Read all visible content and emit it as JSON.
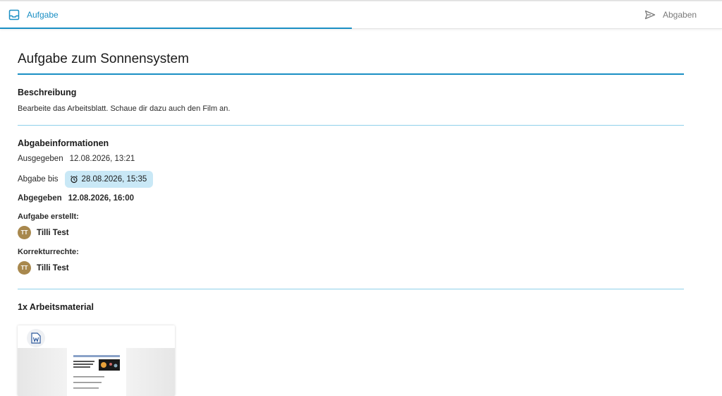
{
  "tabs": [
    {
      "label": "Aufgabe",
      "icon": "inbox-icon",
      "active": true
    },
    {
      "label": "Abgaben",
      "icon": "send-icon",
      "active": false
    }
  ],
  "task": {
    "title": "Aufgabe zum Sonnensystem",
    "description_heading": "Beschreibung",
    "description": "Bearbeite das Arbeitsblatt. Schaue dir dazu auch den Film an."
  },
  "submission_info": {
    "heading": "Abgabeinformationen",
    "issued_label": "Ausgegeben",
    "issued_value": "12.08.2026, 13:21",
    "due_label": "Abgabe bis",
    "due_value": "28.08.2026, 15:35",
    "submitted_label": "Abgegeben",
    "submitted_value": "12.08.2026, 16:00",
    "created_by_label": "Aufgabe erstellt:",
    "created_by": {
      "initials": "TT",
      "name": "Tilli Test"
    },
    "correction_label": "Korrekturrechte:",
    "correction_by": {
      "initials": "TT",
      "name": "Tilli Test"
    }
  },
  "materials": {
    "heading": "1x Arbeitsmaterial",
    "file_icon": "word-document-icon"
  },
  "colors": {
    "accent": "#1a8fc4",
    "chip_bg": "#c9e8f6",
    "avatar": "#a8884d"
  }
}
